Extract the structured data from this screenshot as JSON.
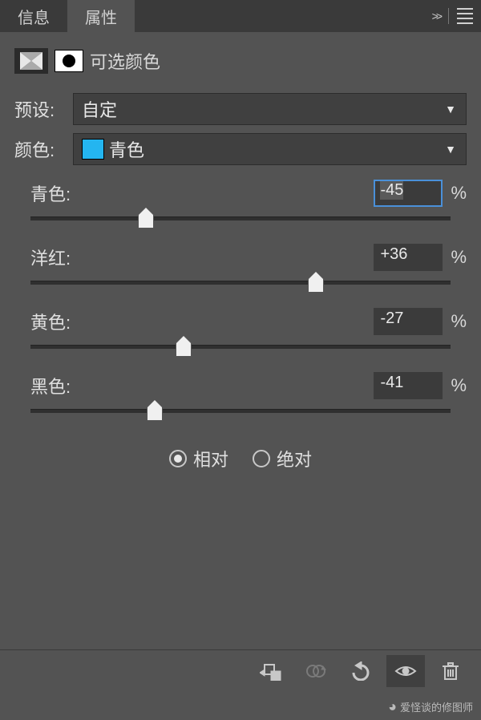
{
  "tabs": {
    "info": "信息",
    "properties": "属性",
    "active": "properties"
  },
  "header": {
    "title": "可选颜色"
  },
  "preset": {
    "label": "预设:",
    "value": "自定"
  },
  "colors": {
    "label": "颜色:",
    "value": "青色",
    "swatch": "#24B5F0"
  },
  "sliders": [
    {
      "name": "青色:",
      "value": "-45",
      "focused": true,
      "pos": 27.5
    },
    {
      "name": "洋红:",
      "value": "+36",
      "focused": false,
      "pos": 68
    },
    {
      "name": "黄色:",
      "value": "-27",
      "focused": false,
      "pos": 36.5
    },
    {
      "name": "黑色:",
      "value": "-41",
      "focused": false,
      "pos": 29.5
    }
  ],
  "mode": {
    "relative": "相对",
    "absolute": "绝对",
    "selected": "relative"
  },
  "percent": "%",
  "toolbar": {
    "items": [
      "clip-to-layer-icon",
      "sync-icon",
      "revert-icon",
      "visibility-icon",
      "trash-icon"
    ],
    "active": "visibility-icon"
  },
  "watermark": {
    "text": "爱怪谈的修图师"
  }
}
